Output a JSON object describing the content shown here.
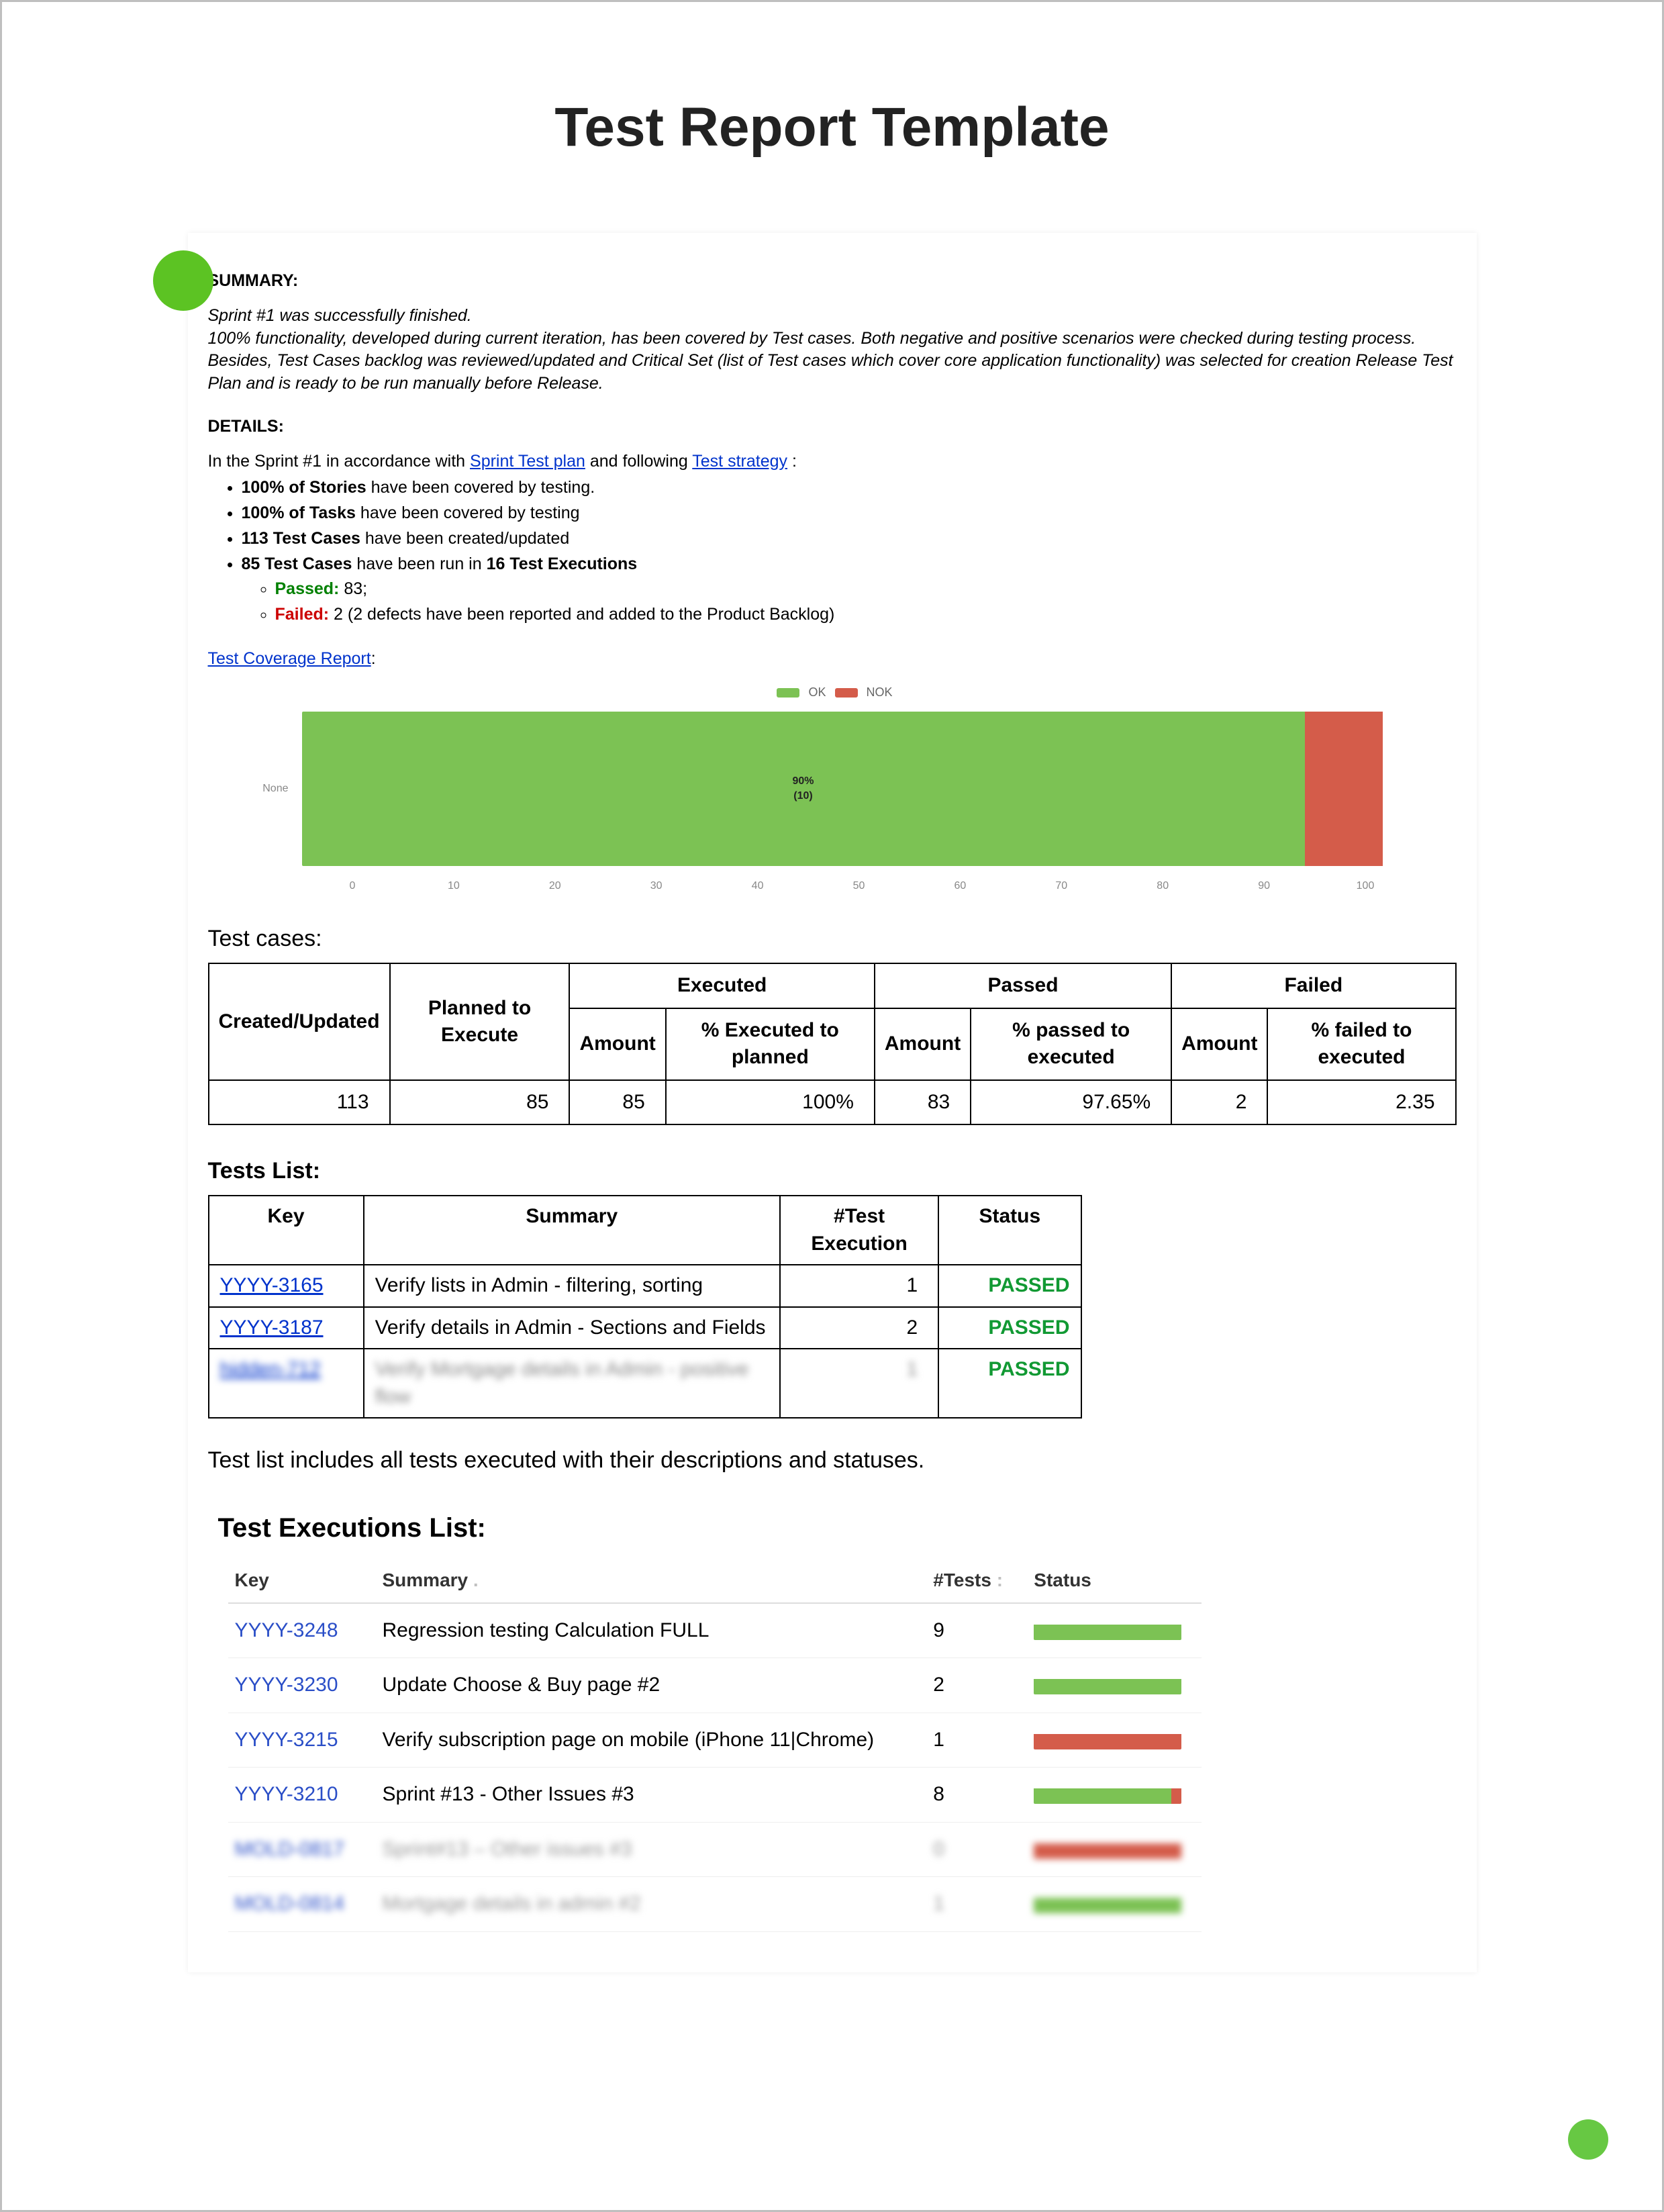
{
  "title": "Test Report Template",
  "summary": {
    "heading": "SUMMARY:",
    "line1": "Sprint #1 was successfully finished.",
    "line2": "100%  functionality, developed during current iteration, has been covered by Test cases. Both negative and positive scenarios were checked during testing process.",
    "line3": "Besides, Test Cases backlog was reviewed/updated and Critical Set (list of Test cases which cover core application functionality) was selected for creation Release Test Plan and is ready to be run manually before Release."
  },
  "details": {
    "heading": "DETAILS:",
    "intro_pre": "In the Sprint #1 in accordance with ",
    "link1": "Sprint Test plan",
    "intro_mid": " and following ",
    "link2": "Test strategy",
    "intro_post": ":",
    "bullets": {
      "b1_bold": "100% of Stories",
      "b1_rest": " have been covered by testing.",
      "b2_bold": "100% of Tasks",
      "b2_rest": " have been covered by testing",
      "b3_bold": "113 Test Cases",
      "b3_rest": " have been created/updated",
      "b4_bold_a": "85 Test Cases ",
      "b4_mid": " have been run in ",
      "b4_bold_b": "16 Test Executions",
      "passed_label": "Passed:",
      "passed_rest": " 83;",
      "failed_label": "Failed:",
      "failed_rest": " 2 (2 defects have been reported and added to the Product Backlog)"
    }
  },
  "coverage_link": "Test Coverage Report",
  "chart_data": {
    "type": "bar",
    "orientation": "horizontal-stacked",
    "title": "",
    "categories": [
      "None"
    ],
    "series": [
      {
        "name": "OK",
        "values": [
          90
        ],
        "color": "#7cc254"
      },
      {
        "name": "NOK",
        "values": [
          7
        ],
        "color": "#d45c4a"
      }
    ],
    "data_label": "90%\n(10)",
    "xlim": [
      0,
      100
    ],
    "x_ticks": [
      "0",
      "10",
      "20",
      "30",
      "40",
      "50",
      "60",
      "70",
      "80",
      "90",
      "100"
    ],
    "legend": {
      "ok": "OK",
      "nok": "NOK"
    }
  },
  "test_cases": {
    "label": "Test cases:",
    "headers": {
      "cu": "Created/Updated",
      "pte": "Planned to Execute",
      "executed": "Executed",
      "passed": "Passed",
      "failed": "Failed",
      "amount": "Amount",
      "pct_exec": "% Executed to planned",
      "pct_pass": "% passed to executed",
      "pct_fail": "% failed to executed"
    },
    "row": {
      "created": "113",
      "planned": "85",
      "exec_amount": "85",
      "exec_pct": "100%",
      "pass_amount": "83",
      "pass_pct": "97.65%",
      "fail_amount": "2",
      "fail_pct": "2.35"
    }
  },
  "tests_list": {
    "label": "Tests List:",
    "headers": {
      "key": "Key",
      "summary": "Summary",
      "count": "#Test Execution",
      "status": "Status"
    },
    "rows": [
      {
        "key": "YYYY-3165",
        "summary": "Verify lists in Admin - filtering, sorting",
        "count": "1",
        "status": "PASSED",
        "blur": false
      },
      {
        "key": "YYYY-3187",
        "summary": "Verify details in Admin - Sections and Fields",
        "count": "2",
        "status": "PASSED",
        "blur": false
      },
      {
        "key": "hidden-712",
        "summary": "Verify Mortgage details in Admin - positive flow",
        "count": "1",
        "status": "PASSED",
        "blur": true
      }
    ]
  },
  "tests_list_caption": "Test list includes all tests executed with their descriptions and statuses.",
  "executions": {
    "label": "Test Executions List:",
    "headers": {
      "key": "Key",
      "summary": "Summary",
      "tests": "#Tests",
      "sep": ":",
      "status": "Status"
    },
    "rows": [
      {
        "key": "YYYY-3248",
        "summary": "Regression testing Calculation FULL",
        "tests": "9",
        "pass": 100,
        "fail": 0,
        "blur": false
      },
      {
        "key": "YYYY-3230",
        "summary": "Update Choose & Buy page #2",
        "tests": "2",
        "pass": 100,
        "fail": 0,
        "blur": false
      },
      {
        "key": "YYYY-3215",
        "summary": "Verify subscription page on mobile (iPhone 11|Chrome)",
        "tests": "1",
        "pass": 0,
        "fail": 100,
        "blur": false
      },
      {
        "key": "YYYY-3210",
        "summary": "Sprint #13 - Other Issues #3",
        "tests": "8",
        "pass": 93,
        "fail": 7,
        "blur": false
      },
      {
        "key": "MOLD-0817",
        "summary": "Sprint#13 – Other issues #3",
        "tests": "0",
        "pass": 0,
        "fail": 100,
        "blur": true
      },
      {
        "key": "MOLD-0814",
        "summary": "Mortgage details in admin #2",
        "tests": "1",
        "pass": 100,
        "fail": 0,
        "blur": true
      }
    ]
  }
}
